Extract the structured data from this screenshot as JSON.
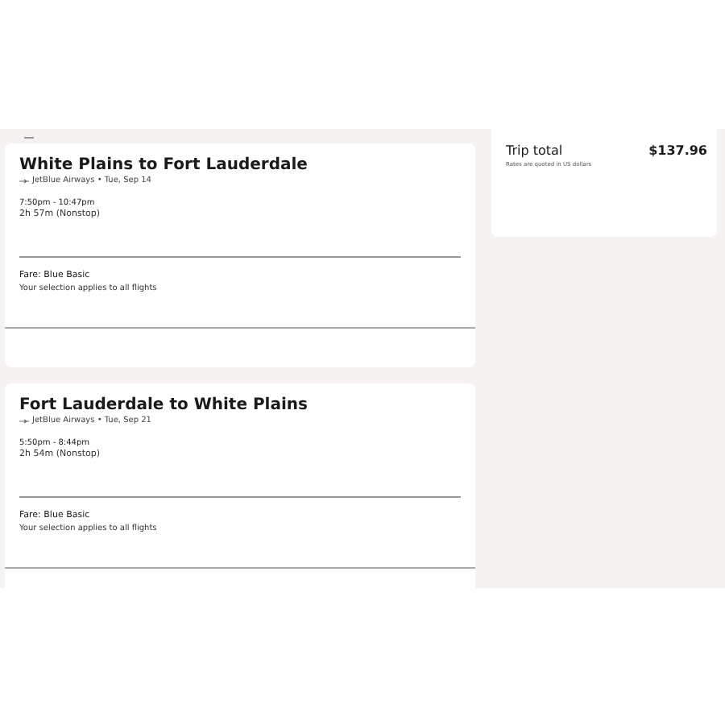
{
  "flights": [
    {
      "route": "White Plains to Fort Lauderdale",
      "airline_date": "JetBlue Airways • Tue, Sep 14",
      "times": "7:50pm - 10:47pm",
      "duration": "2h 57m (Nonstop)",
      "fare": "Fare: Blue Basic",
      "note": "Your selection applies to all flights"
    },
    {
      "route": "Fort Lauderdale to White Plains",
      "airline_date": "JetBlue Airways • Tue, Sep 21",
      "times": "5:50pm - 8:44pm",
      "duration": "2h 54m (Nonstop)",
      "fare": "Fare: Blue Basic",
      "note": "Your selection applies to all flights"
    }
  ],
  "summary": {
    "label": "Trip total",
    "amount": "$137.96",
    "note": "Rates are quoted in US dollars"
  }
}
